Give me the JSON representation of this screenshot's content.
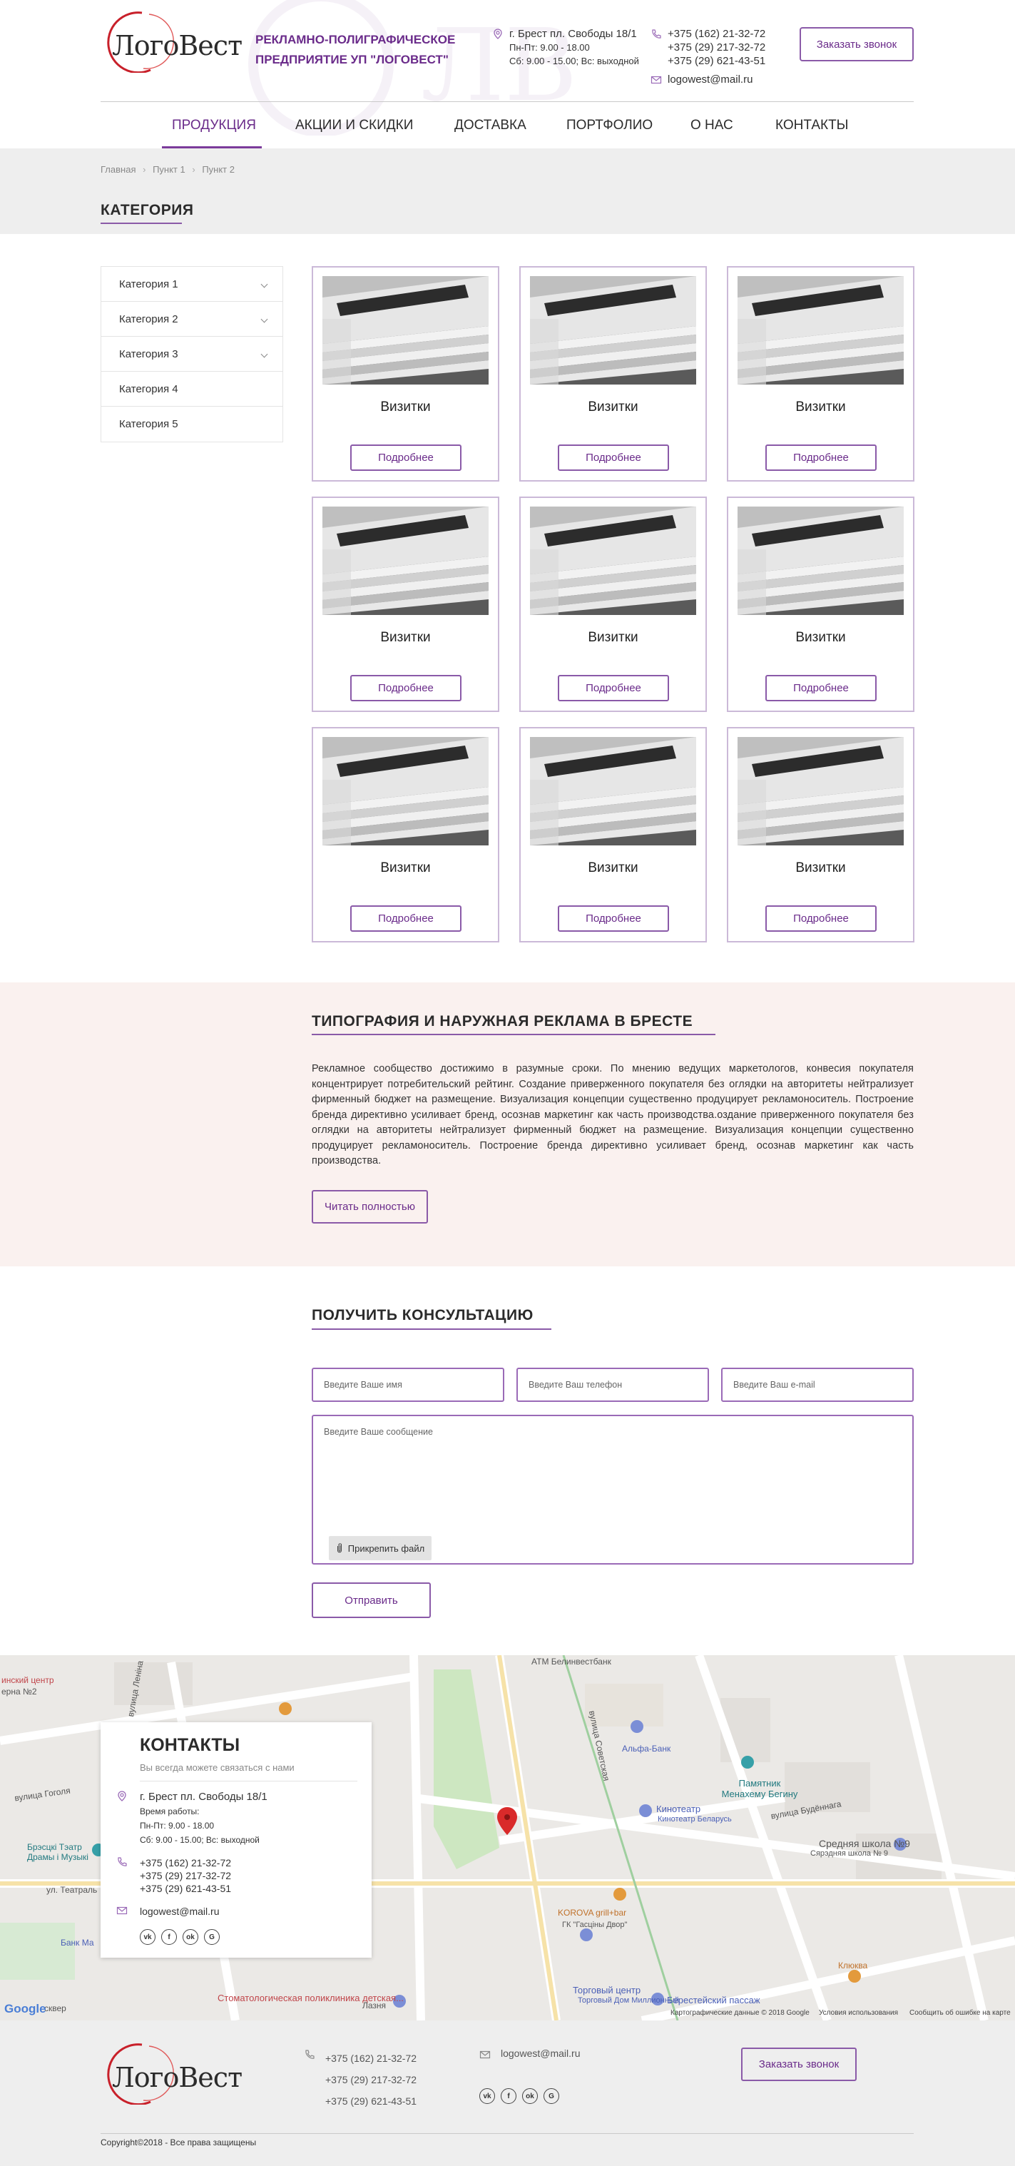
{
  "header": {
    "logo_text": "ЛогоВест",
    "company_line1": "Рекламно-полиграфическое",
    "company_line2": "предприятие УП \"ЛогоВест\"",
    "address": "г. Брест пл. Свободы 18/1",
    "hours_weekdays": "Пн-Пт: 9.00 - 18.00",
    "hours_weekend": "Сб: 9.00 - 15.00; Вс: выходной",
    "phones": [
      "+375 (162) 21-32-72",
      "+375 (29) 217-32-72",
      "+375 (29) 621-43-51"
    ],
    "email": "logowest@mail.ru",
    "callback_label": "Заказать звонок"
  },
  "nav": {
    "items": [
      "Продукция",
      "Акции и скидки",
      "Доставка",
      "Портфолио",
      "О нас",
      "Контакты"
    ],
    "active": "Продукция"
  },
  "breadcrumbs": [
    "Главная",
    "Пункт 1",
    "Пункт 2"
  ],
  "category_title": "Категория",
  "sidebar": {
    "items": [
      {
        "label": "Категория 1",
        "has_children": true
      },
      {
        "label": "Категория 2",
        "has_children": true
      },
      {
        "label": "Категория 3",
        "has_children": true
      },
      {
        "label": "Категория 4",
        "has_children": false
      },
      {
        "label": "Категория 5",
        "has_children": false
      }
    ]
  },
  "products": {
    "card_title": "Визитки",
    "card_button": "Подробнее",
    "count": 9
  },
  "seo": {
    "title": "Типография и наружная реклама в Бресте",
    "text": "Рекламное сообщество достижимо в разумные сроки. По мнению ведущих маркетологов, конвесия покупателя концентрирует потребительский рейтинг. Создание приверженного покупателя без оглядки на авторитеты нейтрализует фирменный бюджет на размещение. Визуализация концепции существенно продуцирует рекламоноситель. Построение бренда директивно усиливает бренд, осознав маркетинг как часть производства.оздание приверженного покупателя без оглядки на авторитеты нейтрализует фирменный бюджет на размещение. Визуализация концепции существенно продуцирует рекламоноситель. Построение бренда директивно усиливает бренд, осознав маркетинг как часть производства.",
    "read_more": "Читать полностью"
  },
  "consult": {
    "title": "Получить консультацию",
    "name_placeholder": "Введите Ваше имя",
    "phone_placeholder": "Введите Ваш телефон",
    "email_placeholder": "Введите Ваш e-mail",
    "message_placeholder": "Введите Ваше сообщение",
    "attach_label": "Прикрепить файл",
    "submit_label": "Отправить"
  },
  "contacts": {
    "title": "Контакты",
    "subtitle": "Вы всегда можете связаться с нами",
    "address": "г. Брест пл. Свободы 18/1",
    "hours_title": "Время работы:",
    "hours_weekdays": "Пн-Пт: 9.00 - 18.00",
    "hours_weekend": "Сб: 9.00 - 15.00; Вс: выходной",
    "phones": [
      "+375 (162) 21-32-72",
      "+375 (29) 217-32-72",
      "+375 (29) 621-43-51"
    ],
    "email": "logowest@mail.ru"
  },
  "map": {
    "labels": [
      "ATM Белинвестбанк",
      "Альфа-Банк",
      "Памятник Менахему Бегину",
      "Кинотеатр",
      "Кинотеатр Беларусь",
      "Средняя школа №9",
      "Сярэдняя школа № 9",
      "KOROVA grill+bar",
      "ГК \"Гасціны Двор\"",
      "Торговый центр",
      "Торговый Дом Миллионный",
      "Берестейский пассаж",
      "Клюква",
      "Стоматологическая поликлиника детская...",
      "Лазня",
      "Брэсцкі Тэатр Драмы і Музыкі",
      "Банк Ма",
      "вулица Гоголя",
      "вулица Будённага",
      "вулица Советская",
      "ул. Театраль",
      "вулица Леніна",
      "инский центр",
      "ерна №2",
      "сквер"
    ],
    "google": "Google",
    "copyright": "Картографические данные © 2018 Google",
    "terms": "Условия использования",
    "report": "Сообщить об ошибке на карте"
  },
  "footer": {
    "phones": [
      "+375 (162) 21-32-72",
      "+375 (29) 217-32-72",
      "+375 (29) 621-43-51"
    ],
    "email": "logowest@mail.ru",
    "callback_label": "Заказать звонок",
    "copyright": "Copyright©2018 - Все права защищены"
  },
  "social": [
    "vk-icon",
    "facebook-icon",
    "odnoklassniki-icon",
    "google-plus-icon"
  ],
  "colors": {
    "accent": "#6a2b8a",
    "border": "#8a5aa8",
    "seo_bg": "#faf1ef",
    "band_bg": "#eeeeee"
  }
}
